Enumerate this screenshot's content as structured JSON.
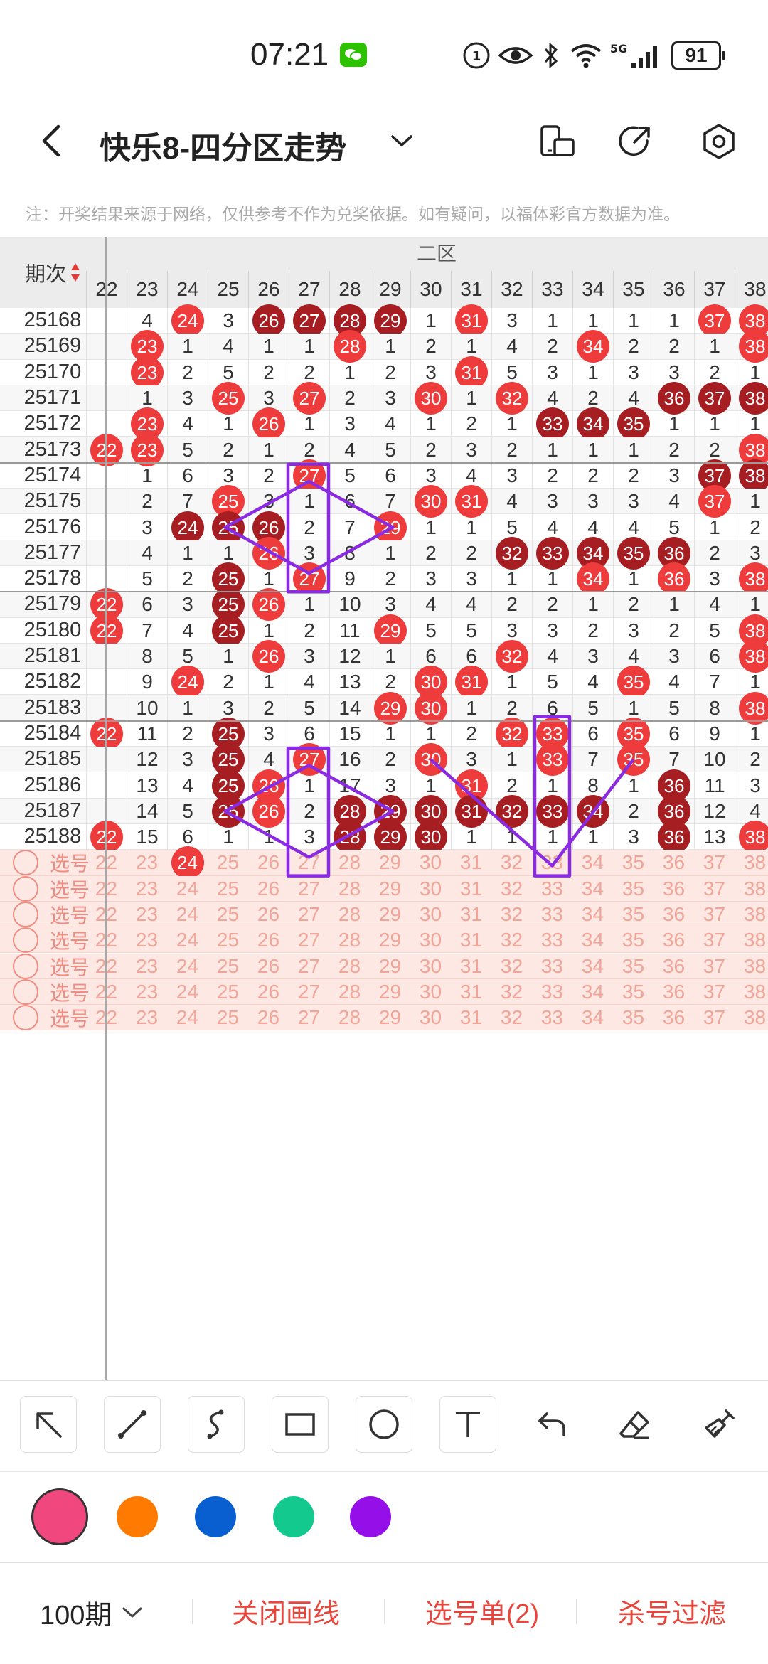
{
  "status_bar": {
    "time": "07:21",
    "battery": "91",
    "network": "5G"
  },
  "header": {
    "title": "快乐8-四分区走势"
  },
  "notice": "注：开奖结果来源于网络，仅供参考不作为兑奖依据。如有疑问，以福体彩官方数据为准。",
  "table": {
    "period_header": "期次",
    "zone_label": "二区",
    "columns": [
      "22",
      "23",
      "24",
      "25",
      "26",
      "27",
      "28",
      "29",
      "30",
      "31",
      "32",
      "33",
      "34",
      "35",
      "36",
      "37",
      "38"
    ],
    "rows": [
      {
        "period": "25168",
        "cells": [
          "",
          "4",
          "b:24",
          "3",
          "d:26",
          "d:27",
          "d:28",
          "d:29",
          "1",
          "b:31",
          "3",
          "1",
          "1",
          "1",
          "1",
          "b:37",
          "b:38"
        ]
      },
      {
        "period": "25169",
        "cells": [
          "",
          "b:23",
          "1",
          "4",
          "1",
          "1",
          "b:28",
          "1",
          "2",
          "1",
          "4",
          "2",
          "b:34",
          "2",
          "2",
          "1",
          "b:38"
        ]
      },
      {
        "period": "25170",
        "cells": [
          "",
          "b:23",
          "2",
          "5",
          "2",
          "2",
          "1",
          "2",
          "3",
          "b:31",
          "5",
          "3",
          "1",
          "3",
          "3",
          "2",
          "1"
        ]
      },
      {
        "period": "25171",
        "cells": [
          "",
          "1",
          "3",
          "b:25",
          "3",
          "b:27",
          "2",
          "3",
          "b:30",
          "1",
          "b:32",
          "4",
          "2",
          "4",
          "d:36",
          "d:37",
          "d:38"
        ]
      },
      {
        "period": "25172",
        "cells": [
          "",
          "b:23",
          "4",
          "1",
          "b:26",
          "1",
          "3",
          "4",
          "1",
          "2",
          "1",
          "d:33",
          "d:34",
          "d:35",
          "1",
          "1",
          "1"
        ]
      },
      {
        "period": "25173",
        "cells": [
          "b:22",
          "b:23",
          "5",
          "2",
          "1",
          "2",
          "4",
          "5",
          "2",
          "3",
          "2",
          "1",
          "1",
          "1",
          "2",
          "2",
          "b:38"
        ]
      },
      {
        "period": "25174",
        "cells": [
          "",
          "1",
          "6",
          "3",
          "2",
          "b:27",
          "5",
          "6",
          "3",
          "4",
          "3",
          "2",
          "2",
          "2",
          "3",
          "d:37",
          "d:38"
        ]
      },
      {
        "period": "25175",
        "cells": [
          "",
          "2",
          "7",
          "b:25",
          "3",
          "1",
          "6",
          "7",
          "b:30",
          "b:31",
          "4",
          "3",
          "3",
          "3",
          "4",
          "b:37",
          "1"
        ]
      },
      {
        "period": "25176",
        "cells": [
          "",
          "3",
          "d:24",
          "d:25",
          "d:26",
          "2",
          "7",
          "b:29",
          "1",
          "1",
          "5",
          "4",
          "4",
          "4",
          "5",
          "1",
          "2"
        ]
      },
      {
        "period": "25177",
        "cells": [
          "",
          "4",
          "1",
          "1",
          "b:26",
          "3",
          "8",
          "1",
          "2",
          "2",
          "d:32",
          "d:33",
          "d:34",
          "d:35",
          "d:36",
          "2",
          "3"
        ]
      },
      {
        "period": "25178",
        "cells": [
          "",
          "5",
          "2",
          "d:25",
          "1",
          "b:27",
          "9",
          "2",
          "3",
          "3",
          "1",
          "1",
          "b:34",
          "1",
          "b:36",
          "3",
          "b:38"
        ]
      },
      {
        "period": "25179",
        "cells": [
          "b:22",
          "6",
          "3",
          "d:25",
          "b:26",
          "1",
          "10",
          "3",
          "4",
          "4",
          "2",
          "2",
          "1",
          "2",
          "1",
          "4",
          "1"
        ]
      },
      {
        "period": "25180",
        "cells": [
          "b:22",
          "7",
          "4",
          "d:25",
          "1",
          "2",
          "11",
          "b:29",
          "5",
          "5",
          "3",
          "3",
          "2",
          "3",
          "2",
          "5",
          "b:38"
        ]
      },
      {
        "period": "25181",
        "cells": [
          "",
          "8",
          "5",
          "1",
          "b:26",
          "3",
          "12",
          "1",
          "6",
          "6",
          "b:32",
          "4",
          "3",
          "4",
          "3",
          "6",
          "b:38"
        ]
      },
      {
        "period": "25182",
        "cells": [
          "",
          "9",
          "b:24",
          "2",
          "1",
          "4",
          "13",
          "2",
          "b:30",
          "b:31",
          "1",
          "5",
          "4",
          "b:35",
          "4",
          "7",
          "1"
        ]
      },
      {
        "period": "25183",
        "cells": [
          "",
          "10",
          "1",
          "3",
          "2",
          "5",
          "14",
          "b:29",
          "b:30",
          "1",
          "2",
          "6",
          "5",
          "1",
          "5",
          "8",
          "b:38"
        ]
      },
      {
        "period": "25184",
        "cells": [
          "b:22",
          "11",
          "2",
          "d:25",
          "3",
          "6",
          "15",
          "1",
          "1",
          "2",
          "b:32",
          "b:33",
          "6",
          "b:35",
          "6",
          "9",
          "1"
        ]
      },
      {
        "period": "25185",
        "cells": [
          "",
          "12",
          "3",
          "d:25",
          "4",
          "b:27",
          "16",
          "2",
          "b:30",
          "3",
          "1",
          "b:33",
          "7",
          "b:35",
          "7",
          "10",
          "2"
        ]
      },
      {
        "period": "25186",
        "cells": [
          "",
          "13",
          "4",
          "d:25",
          "b:26",
          "1",
          "17",
          "3",
          "1",
          "b:31",
          "2",
          "1",
          "8",
          "1",
          "d:36",
          "11",
          "3"
        ]
      },
      {
        "period": "25187",
        "cells": [
          "",
          "14",
          "5",
          "d:25",
          "b:26",
          "2",
          "d:28",
          "d:29",
          "d:30",
          "d:31",
          "d:32",
          "d:33",
          "d:34",
          "2",
          "d:36",
          "12",
          "4"
        ]
      },
      {
        "period": "25188",
        "cells": [
          "b:22",
          "15",
          "6",
          "1",
          "1",
          "3",
          "d:28",
          "d:29",
          "d:30",
          "1",
          "1",
          "1",
          "1",
          "3",
          "d:36",
          "13",
          "b:38"
        ]
      }
    ],
    "pick_label": "选号",
    "pick_rows": [
      {
        "selected": [
          {
            "col": 2,
            "value": "24"
          }
        ]
      },
      {
        "selected": []
      },
      {
        "selected": []
      },
      {
        "selected": []
      },
      {
        "selected": []
      },
      {
        "selected": []
      },
      {
        "selected": []
      }
    ]
  },
  "drawing_color": "#8a2be2",
  "palette": [
    "#f0477f",
    "#ff7a00",
    "#0a5fd0",
    "#13c98d",
    "#9510e8"
  ],
  "bottom_bar": {
    "period_select": "100期",
    "close_drawing": "关闭画线",
    "pick_list": "选号单(2)",
    "kill_filter": "杀号过滤"
  },
  "colors": {
    "ball_red": "#ee3b3b",
    "ball_dark": "#a61e22",
    "accent": "#e8463c",
    "pick_bg": "#fde8e4"
  }
}
